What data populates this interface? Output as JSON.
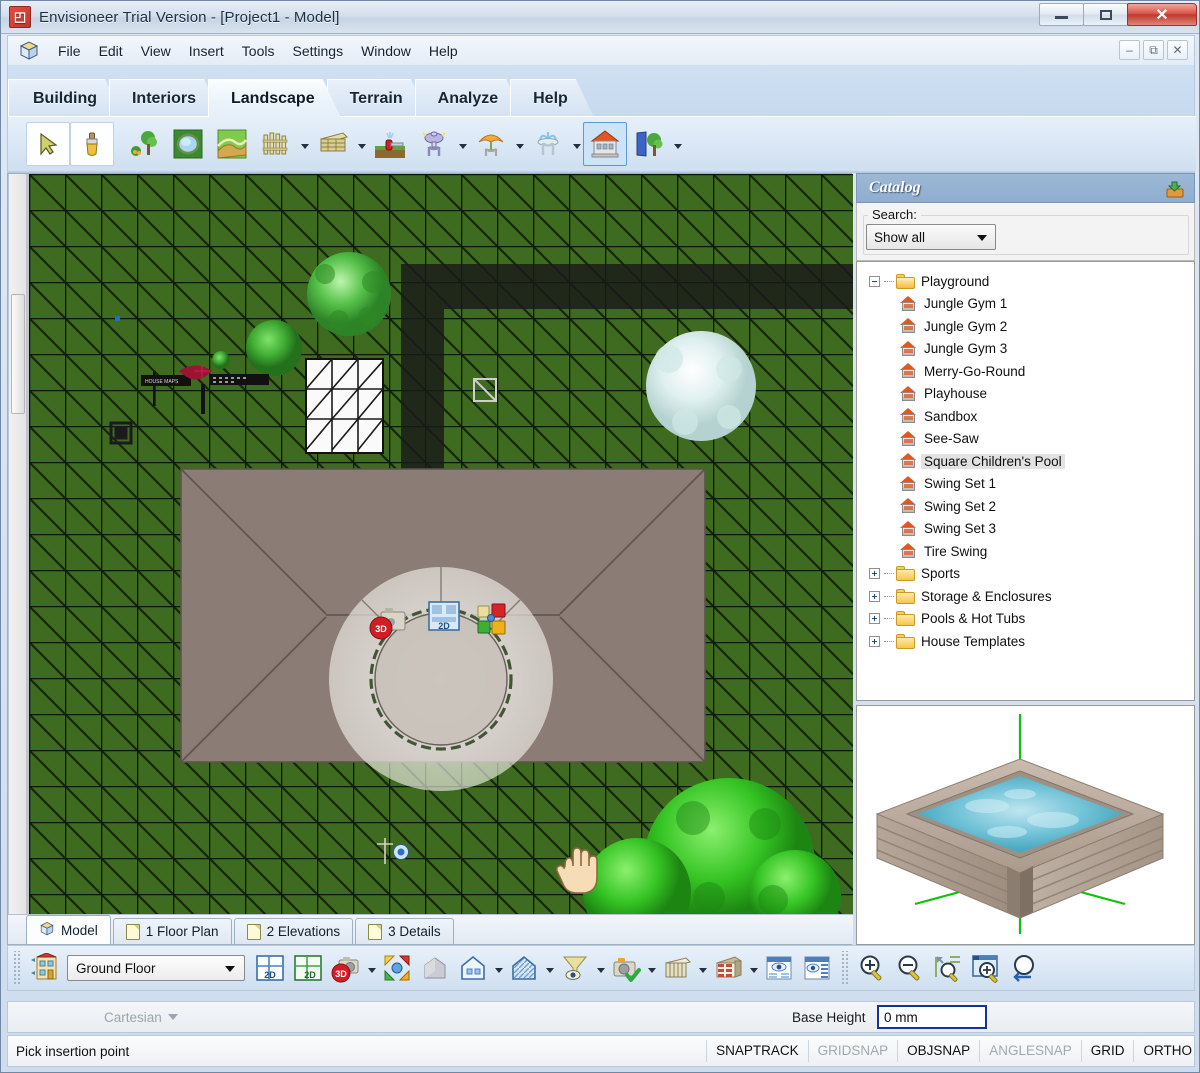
{
  "window": {
    "title": "Envisioneer Trial Version - [Project1 - Model]",
    "app_icon": "envisioneer-logo-icon",
    "minimize": "–",
    "maximize": "□",
    "close": "✕"
  },
  "menu": {
    "doc_icon": "cube-icon",
    "items": [
      {
        "label": "File"
      },
      {
        "label": "Edit"
      },
      {
        "label": "View"
      },
      {
        "label": "Insert"
      },
      {
        "label": "Tools"
      },
      {
        "label": "Settings"
      },
      {
        "label": "Window"
      },
      {
        "label": "Help"
      }
    ],
    "mdi": {
      "minimize": "–",
      "restore": "❐",
      "close": "✕"
    }
  },
  "ribbon": {
    "tabs": [
      {
        "label": "Building",
        "active": false
      },
      {
        "label": "Interiors",
        "active": false
      },
      {
        "label": "Landscape",
        "active": true
      },
      {
        "label": "Terrain",
        "active": false
      },
      {
        "label": "Analyze",
        "active": false
      },
      {
        "label": "Help",
        "active": false
      }
    ],
    "tools": [
      {
        "name": "select-arrow-tool",
        "framed": true,
        "selected": false,
        "dropdown": false
      },
      {
        "name": "paintbrush-tool",
        "framed": true,
        "selected": false,
        "dropdown": false
      },
      {
        "name": "plants-tree-tool",
        "framed": false,
        "selected": false,
        "dropdown": false
      },
      {
        "name": "pond-water-feature-tool",
        "framed": false,
        "selected": false,
        "dropdown": false
      },
      {
        "name": "path-walkway-tool",
        "framed": false,
        "selected": false,
        "dropdown": false
      },
      {
        "name": "fence-tool",
        "framed": false,
        "selected": false,
        "dropdown": true
      },
      {
        "name": "deck-tool",
        "framed": false,
        "selected": false,
        "dropdown": true
      },
      {
        "name": "sprinkler-irrigation-tool",
        "framed": false,
        "selected": false,
        "dropdown": false
      },
      {
        "name": "outdoor-lighting-tool",
        "framed": false,
        "selected": false,
        "dropdown": true
      },
      {
        "name": "patio-umbrella-tool",
        "framed": false,
        "selected": false,
        "dropdown": true
      },
      {
        "name": "fountain-tool",
        "framed": false,
        "selected": false,
        "dropdown": true
      },
      {
        "name": "playground-structure-tool",
        "framed": false,
        "selected": true,
        "dropdown": false
      },
      {
        "name": "landscape-library-tool",
        "framed": false,
        "selected": false,
        "dropdown": true
      }
    ]
  },
  "catalog": {
    "title": "Catalog",
    "header_icon": "export-catalog-icon",
    "search_label": "Search:",
    "filter_value": "Show all",
    "filter_options": [
      "Show all"
    ],
    "tree": [
      {
        "label": "Playground",
        "type": "folder",
        "expanded": true,
        "level": 0
      },
      {
        "label": "Jungle Gym 1",
        "type": "item",
        "level": 1
      },
      {
        "label": "Jungle Gym 2",
        "type": "item",
        "level": 1
      },
      {
        "label": "Jungle Gym 3",
        "type": "item",
        "level": 1
      },
      {
        "label": "Merry-Go-Round",
        "type": "item",
        "level": 1
      },
      {
        "label": "Playhouse",
        "type": "item",
        "level": 1
      },
      {
        "label": "Sandbox",
        "type": "item",
        "level": 1
      },
      {
        "label": "See-Saw",
        "type": "item",
        "level": 1
      },
      {
        "label": "Square Children's Pool",
        "type": "item",
        "level": 1,
        "selected": true
      },
      {
        "label": "Swing Set 1",
        "type": "item",
        "level": 1
      },
      {
        "label": "Swing Set 2",
        "type": "item",
        "level": 1
      },
      {
        "label": "Swing Set 3",
        "type": "item",
        "level": 1
      },
      {
        "label": "Tire Swing",
        "type": "item",
        "level": 1
      },
      {
        "label": "Sports",
        "type": "folder",
        "expanded": false,
        "level": 0
      },
      {
        "label": "Storage & Enclosures",
        "type": "folder",
        "expanded": false,
        "level": 0
      },
      {
        "label": "Pools & Hot Tubs",
        "type": "folder",
        "expanded": false,
        "level": 0
      },
      {
        "label": "House Templates",
        "type": "folder",
        "expanded": false,
        "level": 0
      }
    ],
    "preview_name": "square-childrens-pool-3d-preview"
  },
  "document_tabs": [
    {
      "label": "Model",
      "icon": "cube-icon",
      "active": true
    },
    {
      "label": "1 Floor Plan",
      "icon": "page-icon",
      "active": false
    },
    {
      "label": "2 Elevations",
      "icon": "page-icon",
      "active": false
    },
    {
      "label": "3 Details",
      "icon": "page-icon",
      "active": false
    }
  ],
  "bottom_toolbar": {
    "floor_value": "Ground Floor",
    "floor_options": [
      "Ground Floor"
    ],
    "buttons": [
      {
        "name": "house-levels-icon",
        "dropdown": false
      },
      {
        "name": "view-2d-icon",
        "dropdown": false
      },
      {
        "name": "view-2d-furnished-icon",
        "dropdown": false
      },
      {
        "name": "view-3d-camera-icon",
        "dropdown": true
      },
      {
        "name": "move-arrows-icon",
        "dropdown": false
      },
      {
        "name": "solid-model-icon",
        "dropdown": false
      },
      {
        "name": "house-exterior-icon",
        "dropdown": true
      },
      {
        "name": "hatched-house-icon",
        "dropdown": true
      },
      {
        "name": "filter-view-icon",
        "dropdown": true
      },
      {
        "name": "camera-snapshot-icon",
        "dropdown": true
      },
      {
        "name": "roof-framing-icon",
        "dropdown": true
      },
      {
        "name": "wall-materials-icon",
        "dropdown": true
      },
      {
        "name": "display-properties-icon",
        "dropdown": false
      },
      {
        "name": "display-list-icon",
        "dropdown": false
      },
      {
        "name": "zoom-in-icon",
        "dropdown": false
      },
      {
        "name": "zoom-out-icon",
        "dropdown": false
      },
      {
        "name": "zoom-extents-icon",
        "dropdown": false
      },
      {
        "name": "zoom-window-icon",
        "dropdown": false
      },
      {
        "name": "zoom-previous-icon",
        "dropdown": false
      }
    ]
  },
  "input_bar": {
    "coordinate_mode": "Cartesian",
    "base_height_label": "Base Height",
    "base_height_value": "0 mm"
  },
  "status_bar": {
    "message": "Pick insertion point",
    "flags": [
      {
        "label": "SNAPTRACK",
        "active": true
      },
      {
        "label": "GRIDSNAP",
        "active": false
      },
      {
        "label": "OBJSNAP",
        "active": true
      },
      {
        "label": "ANGLESNAP",
        "active": false
      },
      {
        "label": "GRID",
        "active": true
      },
      {
        "label": "ORTHO",
        "active": true
      }
    ]
  },
  "canvas": {
    "name": "model-drawing-canvas",
    "terrain_color": "#3e6b1f",
    "grid_line_color": "#101c0a",
    "building_roof_color": "#8b7d75",
    "shadow_color": "#2b2b2b",
    "radial_menu": {
      "name": "radial-context-menu",
      "options": [
        {
          "name": "3d-view-option",
          "label": "3D"
        },
        {
          "name": "2d-view-option",
          "label": "2D"
        },
        {
          "name": "color-palette-option",
          "label": ""
        }
      ],
      "cursor": "hand-cursor"
    },
    "objects": [
      {
        "name": "deciduous-tree-large",
        "type": "tree"
      },
      {
        "name": "shrub-medium",
        "type": "shrub"
      },
      {
        "name": "shrub-small",
        "type": "shrub"
      },
      {
        "name": "flowering-tree-white",
        "type": "tree"
      },
      {
        "name": "mailbox-sign",
        "type": "fixture"
      },
      {
        "name": "patio-umbrella-red",
        "type": "fixture"
      },
      {
        "name": "square-marker",
        "type": "marker"
      },
      {
        "name": "glass-roof-structure",
        "type": "structure"
      },
      {
        "name": "hedge-bush-green",
        "type": "shrub"
      }
    ]
  }
}
